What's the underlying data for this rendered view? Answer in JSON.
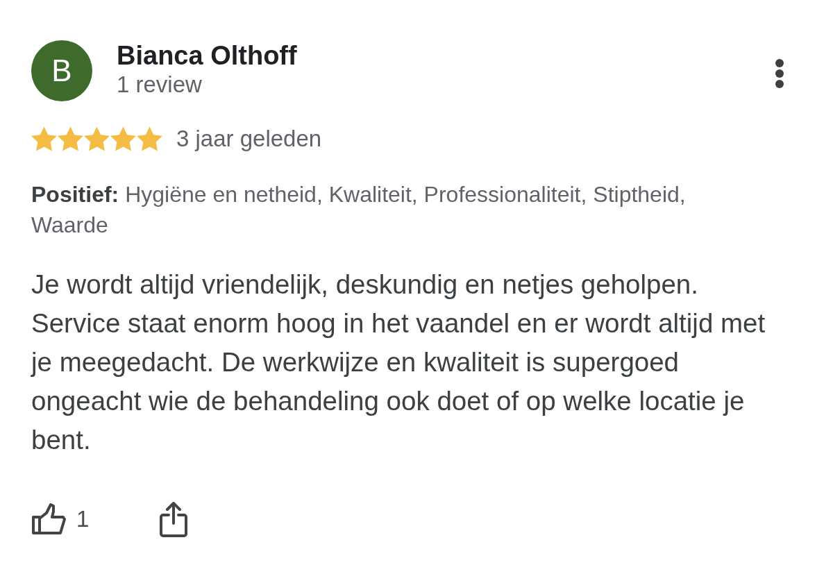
{
  "review": {
    "avatar": {
      "initial": "B"
    },
    "reviewer_name": "Bianca Olthoff",
    "review_count": "1 review",
    "stars": 5,
    "time": "3 jaar geleden",
    "highlights": "**Positief:** Hygiëne en netheid, Kwaliteit, Professionaliteit, Stiptheid, Waarde",
    "text": "Je wordt altijd vriendelijk, deskundig en netjes geholpen. Service staat enorm hoog in het vaandel en er wordt altijd met je meegedacht. De werkwijze en kwaliteit is supergoed ongeacht wie de behandeling ook doet of op welke locatie je bent.",
    "likes": "1"
  }
}
